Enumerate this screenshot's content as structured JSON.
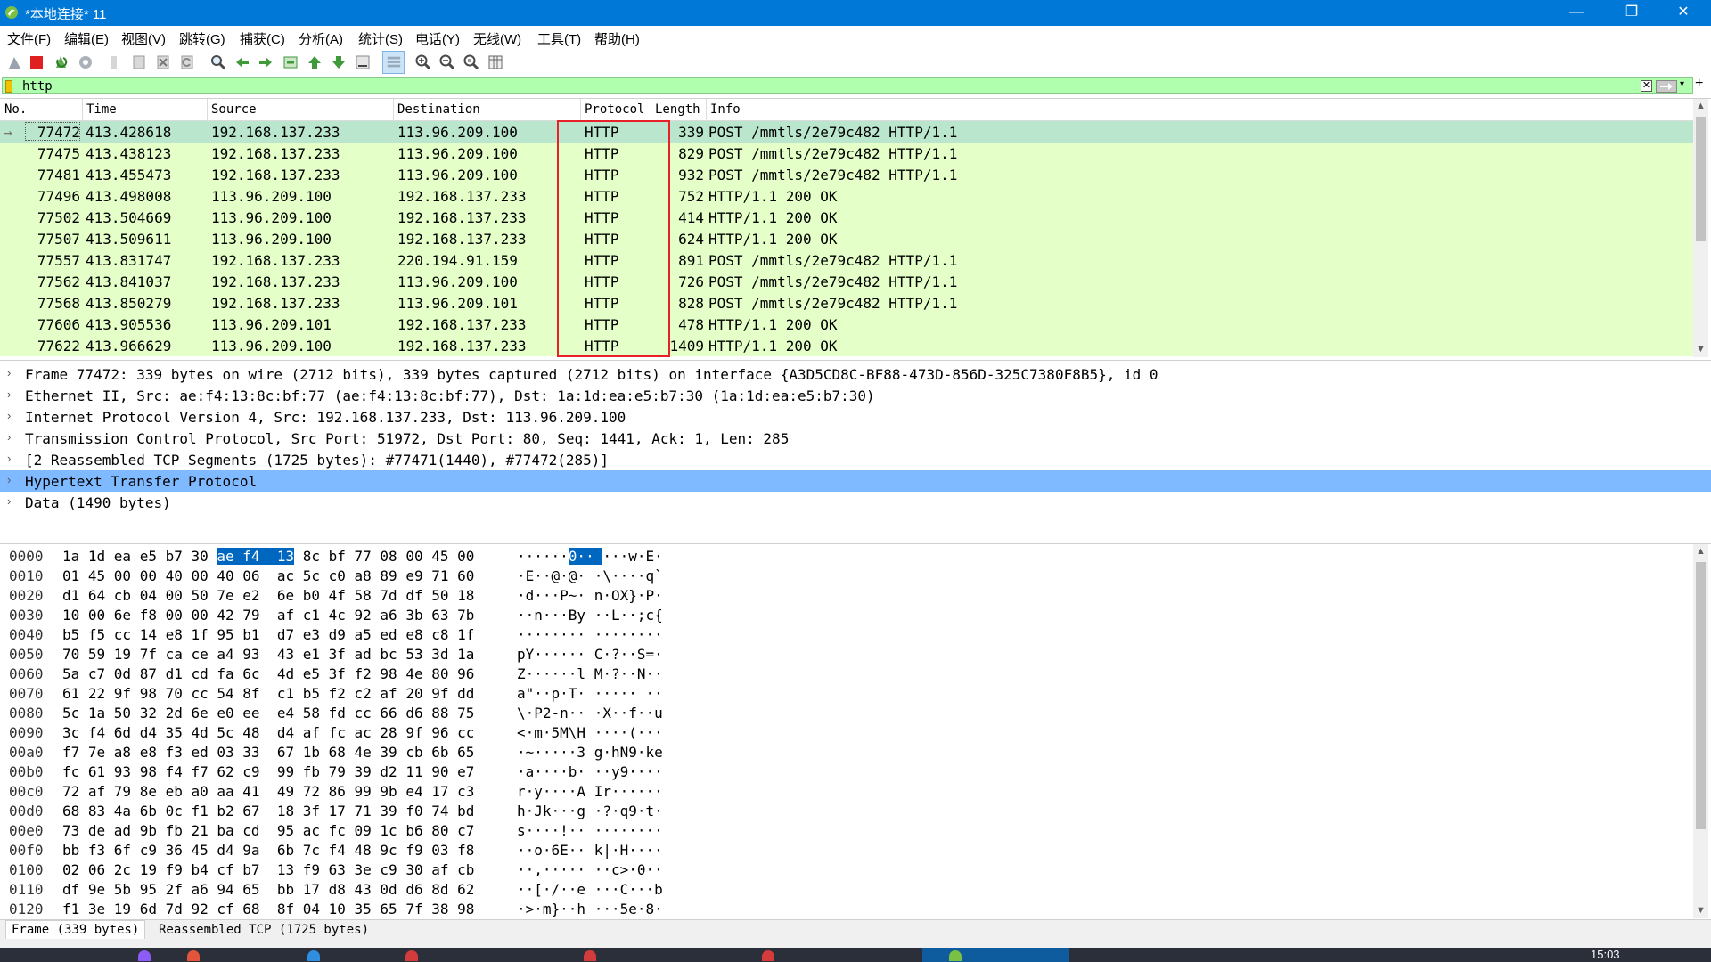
{
  "window": {
    "title": "*本地连接* 11"
  },
  "menu": [
    "文件(F)",
    "编辑(E)",
    "视图(V)",
    "跳转(G)",
    "捕获(C)",
    "分析(A)",
    "统计(S)",
    "电话(Y)",
    "无线(W)",
    "工具(T)",
    "帮助(H)"
  ],
  "toolbar": {
    "icons": [
      "shark-fin-start-icon",
      "stop-capture-icon",
      "restart-capture-icon",
      "capture-options-icon",
      "open-file-icon",
      "save-file-icon",
      "close-file-icon",
      "reload-icon",
      "find-packet-icon",
      "go-back-icon",
      "go-forward-icon",
      "go-to-packet-icon",
      "first-packet-icon",
      "last-packet-icon",
      "autoscroll-icon",
      "colorize-icon",
      "zoom-in-icon",
      "zoom-out-icon",
      "zoom-normal-icon",
      "resize-columns-icon"
    ]
  },
  "filter": {
    "value": "http",
    "bg_color": "#afffaf"
  },
  "packet_list": {
    "columns": [
      "No.",
      "Time",
      "Source",
      "Destination",
      "Protocol",
      "Length",
      "Info"
    ],
    "rows": [
      {
        "no": "77472",
        "time": "413.428618",
        "src": "192.168.137.233",
        "dst": "113.96.209.100",
        "proto": "HTTP",
        "len": "339",
        "info": "POST /mmtls/2e79c482 HTTP/1.1",
        "selected": true
      },
      {
        "no": "77475",
        "time": "413.438123",
        "src": "192.168.137.233",
        "dst": "113.96.209.100",
        "proto": "HTTP",
        "len": "829",
        "info": "POST /mmtls/2e79c482 HTTP/1.1"
      },
      {
        "no": "77481",
        "time": "413.455473",
        "src": "192.168.137.233",
        "dst": "113.96.209.100",
        "proto": "HTTP",
        "len": "932",
        "info": "POST /mmtls/2e79c482 HTTP/1.1"
      },
      {
        "no": "77496",
        "time": "413.498008",
        "src": "113.96.209.100",
        "dst": "192.168.137.233",
        "proto": "HTTP",
        "len": "752",
        "info": "HTTP/1.1 200 OK"
      },
      {
        "no": "77502",
        "time": "413.504669",
        "src": "113.96.209.100",
        "dst": "192.168.137.233",
        "proto": "HTTP",
        "len": "414",
        "info": "HTTP/1.1 200 OK"
      },
      {
        "no": "77507",
        "time": "413.509611",
        "src": "113.96.209.100",
        "dst": "192.168.137.233",
        "proto": "HTTP",
        "len": "624",
        "info": "HTTP/1.1 200 OK"
      },
      {
        "no": "77557",
        "time": "413.831747",
        "src": "192.168.137.233",
        "dst": "220.194.91.159",
        "proto": "HTTP",
        "len": "891",
        "info": "POST /mmtls/2e79c482 HTTP/1.1"
      },
      {
        "no": "77562",
        "time": "413.841037",
        "src": "192.168.137.233",
        "dst": "113.96.209.100",
        "proto": "HTTP",
        "len": "726",
        "info": "POST /mmtls/2e79c482 HTTP/1.1"
      },
      {
        "no": "77568",
        "time": "413.850279",
        "src": "192.168.137.233",
        "dst": "113.96.209.101",
        "proto": "HTTP",
        "len": "828",
        "info": "POST /mmtls/2e79c482 HTTP/1.1"
      },
      {
        "no": "77606",
        "time": "413.905536",
        "src": "113.96.209.101",
        "dst": "192.168.137.233",
        "proto": "HTTP",
        "len": "478",
        "info": "HTTP/1.1 200 OK"
      },
      {
        "no": "77622",
        "time": "413.966629",
        "src": "113.96.209.100",
        "dst": "192.168.137.233",
        "proto": "HTTP",
        "len": "1409",
        "info": "HTTP/1.1 200 OK"
      }
    ],
    "row_color": "#e4ffc7",
    "selected_color": "#b9e6cc"
  },
  "details": {
    "rows": [
      "Frame 77472: 339 bytes on wire (2712 bits), 339 bytes captured (2712 bits) on interface {A3D5CD8C-BF88-473D-856D-325C7380F8B5}, id 0",
      "Ethernet II, Src: ae:f4:13:8c:bf:77 (ae:f4:13:8c:bf:77), Dst: 1a:1d:ea:e5:b7:30 (1a:1d:ea:e5:b7:30)",
      "Internet Protocol Version 4, Src: 192.168.137.233, Dst: 113.96.209.100",
      "Transmission Control Protocol, Src Port: 51972, Dst Port: 80, Seq: 1441, Ack: 1, Len: 285",
      "[2 Reassembled TCP Segments (1725 bytes): #77471(1440), #77472(285)]",
      "Hypertext Transfer Protocol",
      "Data (1490 bytes)"
    ],
    "selected_index": 5
  },
  "bytes": {
    "rows": [
      {
        "off": "0000",
        "hex": "1a 1d ea e5 b7 30 ae f4  13 8c bf 77 08 00 45 00",
        "asc": "······0·· ···w·E·"
      },
      {
        "off": "0010",
        "hex": "01 45 00 00 40 00 40 06  ac 5c c0 a8 89 e9 71 60",
        "asc": "·E··@·@· ·\\····q`"
      },
      {
        "off": "0020",
        "hex": "d1 64 cb 04 00 50 7e e2  6e b0 4f 58 7d df 50 18",
        "asc": "·d···P~· n·OX}·P·"
      },
      {
        "off": "0030",
        "hex": "10 00 6e f8 00 00 42 79  af c1 4c 92 a6 3b 63 7b",
        "asc": "··n···By ··L··;c{"
      },
      {
        "off": "0040",
        "hex": "b5 f5 cc 14 e8 1f 95 b1  d7 e3 d9 a5 ed e8 c8 1f",
        "asc": "········ ········"
      },
      {
        "off": "0050",
        "hex": "70 59 19 7f ca ce a4 93  43 e1 3f ad bc 53 3d 1a",
        "asc": "pY······ C·?··S=·"
      },
      {
        "off": "0060",
        "hex": "5a c7 0d 87 d1 cd fa 6c  4d e5 3f f2 98 4e 80 96",
        "asc": "Z······l M·?··N··"
      },
      {
        "off": "0070",
        "hex": "61 22 9f 98 70 cc 54 8f  c1 b5 f2 c2 af 20 9f dd",
        "asc": "a\"··p·T· ····· ··"
      },
      {
        "off": "0080",
        "hex": "5c 1a 50 32 2d 6e e0 ee  e4 58 fd cc 66 d6 88 75",
        "asc": "\\·P2-n·· ·X··f··u"
      },
      {
        "off": "0090",
        "hex": "3c f4 6d d4 35 4d 5c 48  d4 af fc ac 28 9f 96 cc",
        "asc": "<·m·5M\\H ····(···"
      },
      {
        "off": "00a0",
        "hex": "f7 7e a8 e8 f3 ed 03 33  67 1b 68 4e 39 cb 6b 65",
        "asc": "·~·····3 g·hN9·ke"
      },
      {
        "off": "00b0",
        "hex": "fc 61 93 98 f4 f7 62 c9  99 fb 79 39 d2 11 90 e7",
        "asc": "·a····b· ··y9····"
      },
      {
        "off": "00c0",
        "hex": "72 af 79 8e eb a0 aa 41  49 72 86 99 9b e4 17 c3",
        "asc": "r·y····A Ir······"
      },
      {
        "off": "00d0",
        "hex": "68 83 4a 6b 0c f1 b2 67  18 3f 17 71 39 f0 74 bd",
        "asc": "h·Jk···g ·?·q9·t·"
      },
      {
        "off": "00e0",
        "hex": "73 de ad 9b fb 21 ba cd  95 ac fc 09 1c b6 80 c7",
        "asc": "s····!·· ········"
      },
      {
        "off": "00f0",
        "hex": "bb f3 6f c9 36 45 d4 9a  6b 7c f4 48 9c f9 03 f8",
        "asc": "··o·6E·· k|·H····"
      },
      {
        "off": "0100",
        "hex": "02 06 2c 19 f9 b4 cf b7  13 f9 63 3e c9 30 af cb",
        "asc": "··,····· ··c>·0··"
      },
      {
        "off": "0110",
        "hex": "df 9e 5b 95 2f a6 94 65  bb 17 d8 43 0d d6 8d 62",
        "asc": "··[·/··e ···C···b"
      },
      {
        "off": "0120",
        "hex": "f1 3e 19 6d 7d 92 cf 68  8f 04 10 35 65 7f 38 98",
        "asc": "·>·m}··h ···5e·8·"
      }
    ],
    "highlight_hex": "ae f4  13",
    "tabs": [
      "Frame (339 bytes)",
      "Reassembled TCP (1725 bytes)"
    ]
  },
  "taskbar": {
    "clock": "15:03"
  }
}
